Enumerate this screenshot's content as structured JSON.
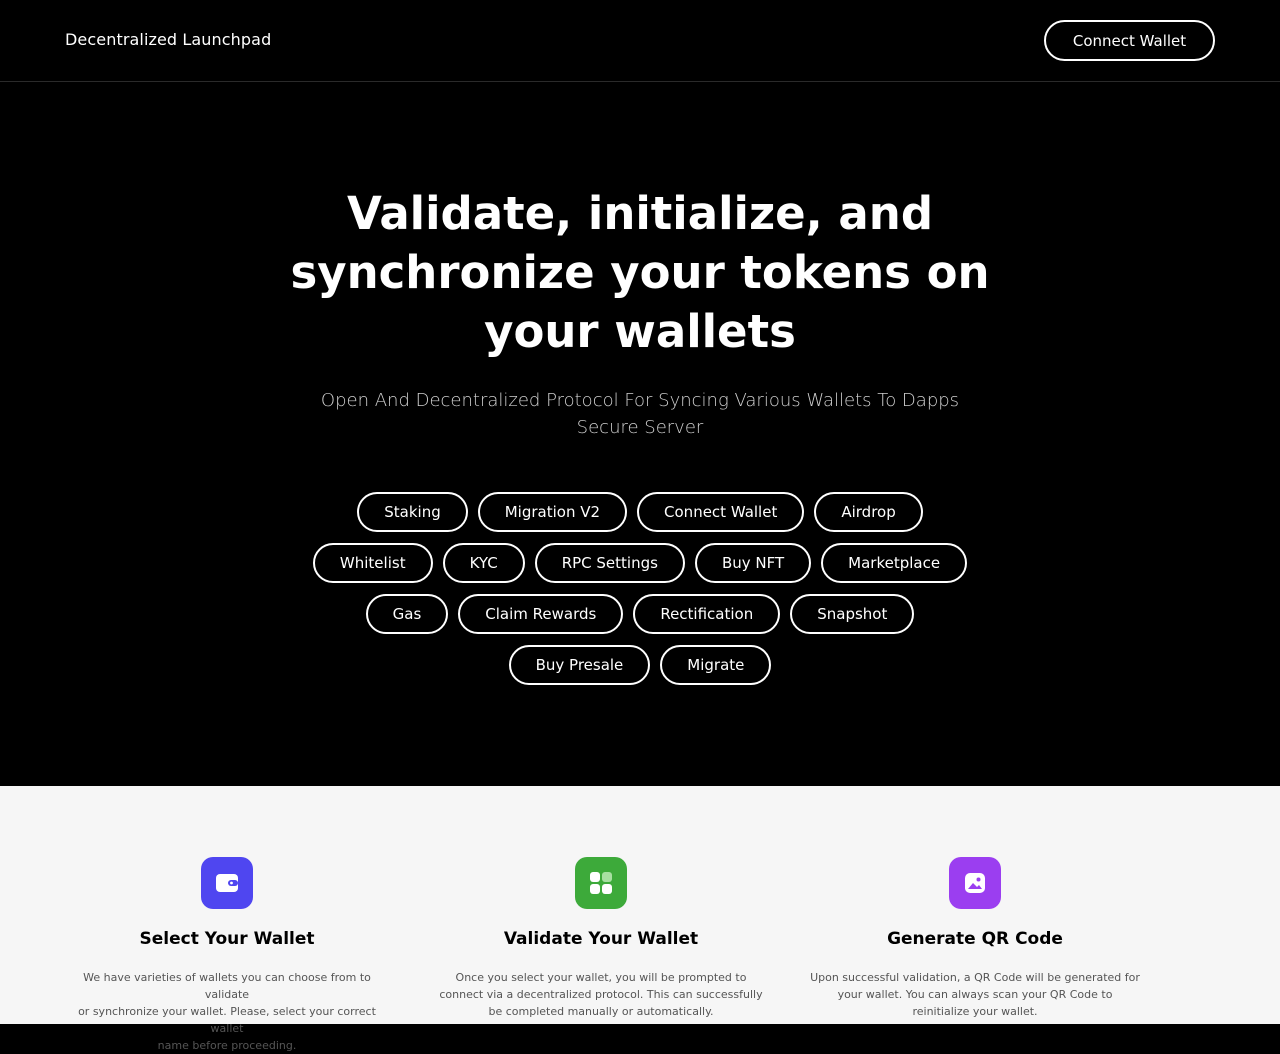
{
  "header": {
    "brand": "Decentralized Launchpad",
    "connect_label": "Connect Wallet"
  },
  "hero": {
    "title_line1": "Validate, initialize, and",
    "title_line2": "synchronize your tokens on",
    "title_line3": "your wallets",
    "subtitle_line1": "Open And Decentralized Protocol For Syncing Various Wallets To Dapps",
    "subtitle_line2": "Secure Server",
    "chip_rows": [
      [
        "Staking",
        "Migration V2",
        "Connect Wallet",
        "Airdrop"
      ],
      [
        "Whitelist",
        "KYC",
        "RPC Settings",
        "Buy NFT",
        "Marketplace"
      ],
      [
        "Gas",
        "Claim Rewards",
        "Rectification",
        "Snapshot"
      ],
      [
        "Buy Presale",
        "Migrate"
      ]
    ]
  },
  "features": [
    {
      "icon": "wallet-icon",
      "color": "#4f46f0",
      "title": "Select Your Wallet",
      "desc_line1": "We have varieties of wallets you can choose from to validate",
      "desc_line2": "or synchronize your wallet. Please, select your correct wallet",
      "desc_line3": "name before proceeding."
    },
    {
      "icon": "grid-icon",
      "color": "#3daa3a",
      "title": "Validate Your Wallet",
      "desc_line1": "Once you select your wallet, you will be prompted to",
      "desc_line2": "connect via a decentralized protocol. This can successfully",
      "desc_line3": "be completed manually or automatically."
    },
    {
      "icon": "image-icon",
      "color": "#9b3ef0",
      "title": "Generate QR Code",
      "desc_line1": "Upon successful validation, a QR Code will be generated for",
      "desc_line2": "your wallet. You can always scan your QR Code to",
      "desc_line3": "reinitialize your wallet."
    }
  ],
  "colors": {
    "background": "#000000",
    "features_bg": "#f6f6f6"
  }
}
